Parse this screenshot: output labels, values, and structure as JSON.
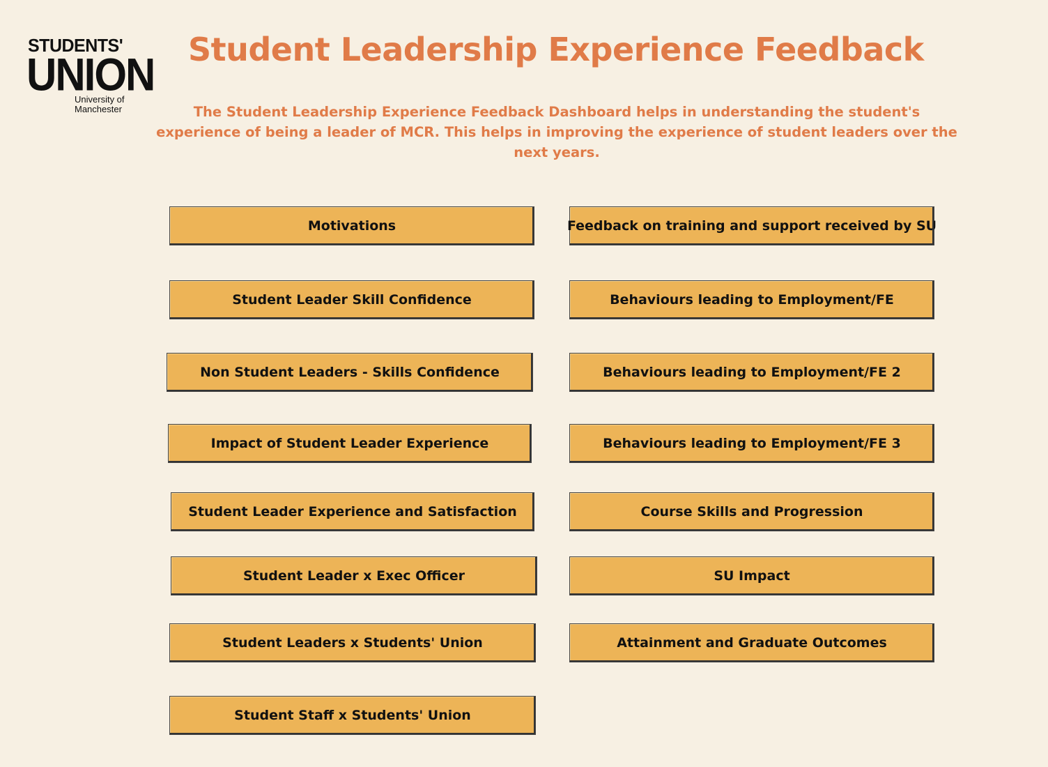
{
  "logo": {
    "line1": "STUDENTS'",
    "line2": "UNION",
    "line3": "University of",
    "line4": "Manchester"
  },
  "header": {
    "title": "Student Leadership Experience Feedback",
    "description": "The Student Leadership Experience Feedback Dashboard helps in understanding the student's experience of being a leader of MCR. This helps in improving the experience of student leaders over the next years."
  },
  "buttons": {
    "motivations": "Motivations",
    "skill_confidence": "Student Leader Skill Confidence",
    "non_leaders_skills": "Non Student Leaders - Skills Confidence",
    "impact": "Impact of Student Leader Experience",
    "experience_satisfaction": "Student Leader Experience and Satisfaction",
    "exec_officer": "Student Leader x Exec Officer",
    "leaders_union": "Student Leaders x Students' Union",
    "staff_union": "Student Staff x Students' Union",
    "training_support": "Feedback on training and support received by SU",
    "employment_1": "Behaviours leading to Employment/FE",
    "employment_2": "Behaviours leading to Employment/FE 2",
    "employment_3": "Behaviours leading to Employment/FE 3",
    "course_skills": "Course Skills and Progression",
    "su_impact": "SU Impact",
    "attainment": "Attainment and Graduate Outcomes"
  },
  "colors": {
    "background": "#f7f0e3",
    "accent": "#e07b48",
    "button_fill": "#edb457"
  }
}
